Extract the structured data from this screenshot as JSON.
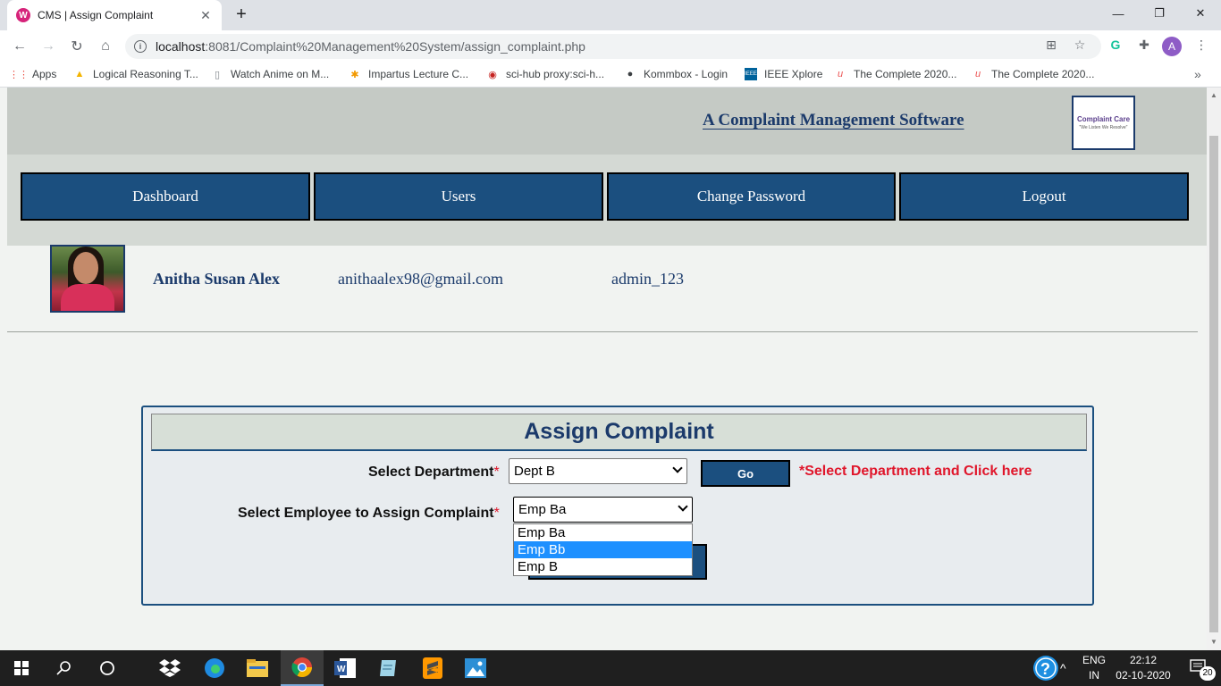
{
  "browser": {
    "tab_title": "CMS | Assign Complaint",
    "tab_favicon_letter": "W",
    "url_host": "localhost",
    "url_path": ":8081/Complaint%20Management%20System/assign_complaint.php",
    "profile_initial": "A",
    "bookmarks": [
      {
        "label": "Apps",
        "icon": "apps-grid-icon"
      },
      {
        "label": "Logical Reasoning T...",
        "icon": "drive-icon"
      },
      {
        "label": "Watch Anime on M...",
        "icon": "page-icon"
      },
      {
        "label": "Impartus Lecture C...",
        "icon": "impartus-icon"
      },
      {
        "label": "sci-hub proxy:sci-h...",
        "icon": "scihub-icon"
      },
      {
        "label": "Kommbox - Login",
        "icon": "globe-icon"
      },
      {
        "label": "IEEE Xplore",
        "icon": "ieee-icon"
      },
      {
        "label": "The Complete 2020...",
        "icon": "udemy-icon"
      },
      {
        "label": "The Complete 2020...",
        "icon": "udemy-icon"
      }
    ]
  },
  "site": {
    "title": "A Complaint Management Software",
    "logo_title": "Complaint Care",
    "logo_subtitle": "\"We Listen We Resolve\""
  },
  "nav": {
    "items": [
      "Dashboard",
      "Users",
      "Change Password",
      "Logout"
    ]
  },
  "profile": {
    "name": "Anitha Susan Alex",
    "email": "anithaalex98@gmail.com",
    "role": "admin_123"
  },
  "form": {
    "heading": "Assign Complaint",
    "department_label": "Select Department",
    "department_value": "Dept B",
    "go_label": "Go",
    "hint": "*Select Department and Click here",
    "employee_label": "Select Employee to Assign Complaint",
    "employee_value": "Emp Ba",
    "required_mark": "*",
    "employee_options": [
      "Emp Ba",
      "Emp Bb",
      "Emp B"
    ],
    "highlighted_option": "Emp Bb"
  },
  "taskbar": {
    "lang_top": "ENG",
    "lang_bottom": "IN",
    "time": "22:12",
    "date": "02-10-2020",
    "notification_count": "20"
  },
  "colors": {
    "nav_bg": "#1b4f7f",
    "title_color": "#1b3a6b",
    "required_red": "#e0162b",
    "highlight_blue": "#1e90ff"
  }
}
